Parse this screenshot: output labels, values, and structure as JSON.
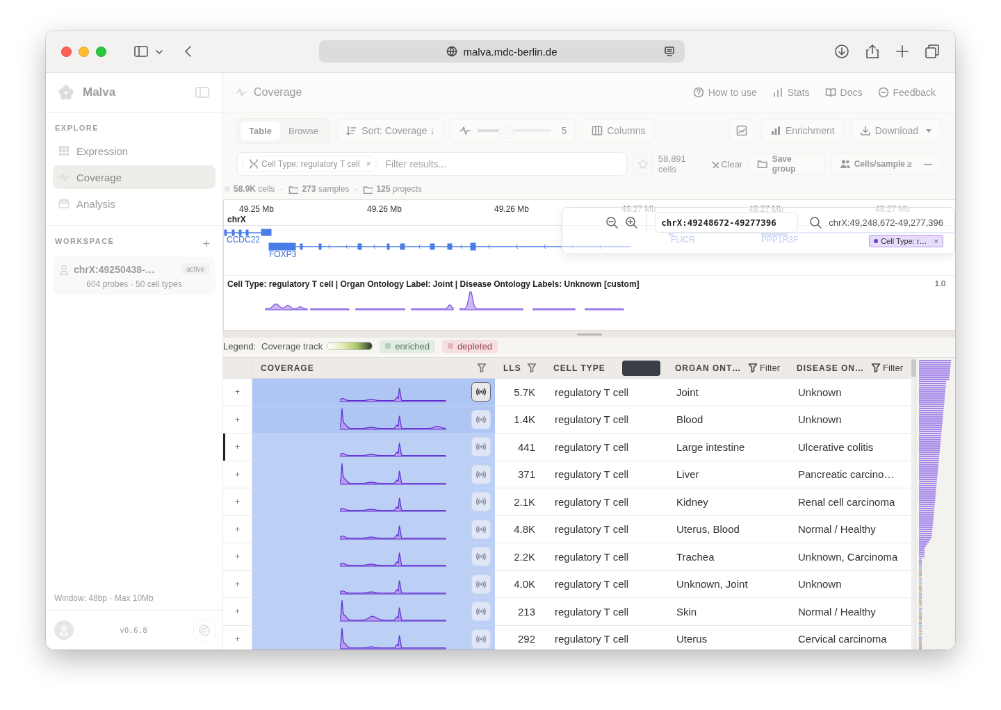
{
  "browser": {
    "url": "malva.mdc-berlin.de"
  },
  "sidebar": {
    "app_name": "Malva",
    "explore_title": "EXPLORE",
    "nav": [
      {
        "label": "Expression",
        "selected": false
      },
      {
        "label": "Coverage",
        "selected": true
      },
      {
        "label": "Analysis",
        "selected": false
      }
    ],
    "workspace_title": "WORKSPACE",
    "add": "+",
    "workspace_items": [
      {
        "name": "chrX:49250438-…",
        "badge": "active",
        "details": "604 probes · 50 cell types"
      }
    ],
    "window_info": "Window: 48bp · Max 10Mb",
    "version": "v0.6.8"
  },
  "header": {
    "title": "Coverage",
    "links": [
      "How to use",
      "Stats",
      "Docs",
      "Feedback"
    ]
  },
  "toolbar": {
    "view_tabs": [
      {
        "label": "Table",
        "selected": true
      },
      {
        "label": "Browse",
        "selected": false
      }
    ],
    "sort": "Sort: Coverage ↓",
    "smoothing": {
      "level": 0.4,
      "reading": "5"
    },
    "columns": "Columns",
    "enrichment": "Enrichment",
    "download": "Download"
  },
  "filter_bar": {
    "chips": [
      {
        "label": "Cell Type: regulatory T cell",
        "remove": "×"
      }
    ],
    "placeholder": "Filter results...",
    "cell_count": "58,891 cells",
    "clear": "Clear",
    "save_group": "Save group",
    "cells_per_sample": "Cells/sample ≥",
    "more": "—"
  },
  "stats": [
    {
      "kind": "stat",
      "text": "**58.9K** cells"
    },
    {
      "kind": "separator",
      "text": "·"
    },
    {
      "kind": "stat",
      "text": "**273** samples"
    },
    {
      "kind": "separator",
      "text": "·"
    },
    {
      "kind": "stat",
      "text": "**125** projects"
    }
  ],
  "genome_browser": {
    "ticks": [
      "49.25 Mb",
      "49.26 Mb",
      "49.26 Mb",
      "49.27 Mb",
      "49.27 Mb",
      "49.27 Mb"
    ],
    "chromosome": "chrX",
    "genes": [
      "CCDC22",
      "FOXP3",
      "FLICR",
      "PPP1R3F"
    ],
    "track_title": "Cell Type: regulatory T cell | Organ Ontology Label: Joint | Disease Ontology Labels: Unknown [custom]",
    "track_max": "1.0",
    "locus_popup": {
      "locus_input": "chrX:49248672-49277396",
      "locus_text": "chrX:49,248,672-49,277,396",
      "chips": [
        {
          "label": "Cell Type: r…",
          "remove": "×",
          "color": "#6a3fd8"
        }
      ]
    }
  },
  "legend": {
    "title": "Legend:",
    "coverage_track": "Coverage track",
    "enriched": "enriched",
    "depleted": "depleted"
  },
  "table": {
    "columns": [
      {
        "label": "COVERAGE",
        "filterable": true
      },
      {
        "label": "LLS",
        "filterable": true
      },
      {
        "label": "CELL TYPE",
        "filterable": false
      },
      {
        "label": "ORGAN ONT…",
        "filterable": true,
        "filter_label": "Filter"
      },
      {
        "label": "DISEASE ON…",
        "filterable": true,
        "filter_label": "Filter"
      }
    ],
    "rows": [
      {
        "expand": "+",
        "selected": false,
        "signal_active": true,
        "lls": "5.7K",
        "cell_type": "regulatory T cell",
        "organ": "Joint",
        "disease": "Unknown"
      },
      {
        "expand": "+",
        "selected": false,
        "signal_active": false,
        "lls": "1.4K",
        "cell_type": "regulatory T cell",
        "organ": "Blood",
        "disease": "Unknown"
      },
      {
        "expand": "+",
        "selected": true,
        "signal_active": false,
        "lls": "441",
        "cell_type": "regulatory T cell",
        "organ": "Large intestine",
        "disease": "Ulcerative colitis"
      },
      {
        "expand": "+",
        "selected": false,
        "signal_active": false,
        "lls": "371",
        "cell_type": "regulatory T cell",
        "organ": "Liver",
        "disease": "Pancreatic carcino…"
      },
      {
        "expand": "+",
        "selected": false,
        "signal_active": false,
        "lls": "2.1K",
        "cell_type": "regulatory T cell",
        "organ": "Kidney",
        "disease": "Renal cell carcinoma"
      },
      {
        "expand": "+",
        "selected": false,
        "signal_active": false,
        "lls": "4.8K",
        "cell_type": "regulatory T cell",
        "organ": "Uterus, Blood",
        "disease": "Normal / Healthy"
      },
      {
        "expand": "+",
        "selected": false,
        "signal_active": false,
        "lls": "2.2K",
        "cell_type": "regulatory T cell",
        "organ": "Trachea",
        "disease": "Unknown, Carcinoma"
      },
      {
        "expand": "+",
        "selected": false,
        "signal_active": false,
        "lls": "4.0K",
        "cell_type": "regulatory T cell",
        "organ": "Unknown, Joint",
        "disease": "Unknown"
      },
      {
        "expand": "+",
        "selected": false,
        "signal_active": false,
        "lls": "213",
        "cell_type": "regulatory T cell",
        "organ": "Skin",
        "disease": "Normal / Healthy"
      },
      {
        "expand": "+",
        "selected": false,
        "signal_active": false,
        "lls": "292",
        "cell_type": "regulatory T cell",
        "organ": "Uterus",
        "disease": "Cervical carcinoma"
      }
    ]
  }
}
